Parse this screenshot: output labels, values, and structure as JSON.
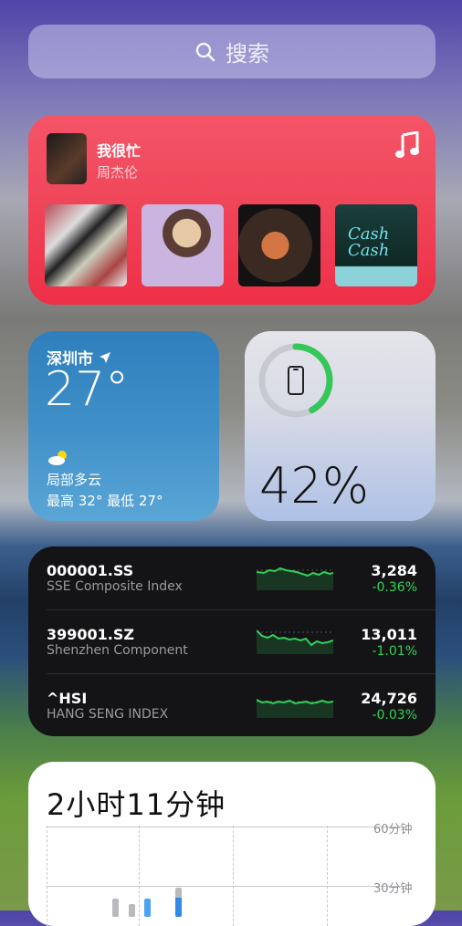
{
  "search": {
    "placeholder": "搜索",
    "icon": "search-icon"
  },
  "music": {
    "title": "我很忙",
    "artist": "周杰伦",
    "app_icon": "music-note-icon",
    "albums": [
      "album-1",
      "album-2",
      "album-3",
      "album-4"
    ],
    "album4_text": "Cash Cash"
  },
  "weather": {
    "city": "深圳市",
    "temperature": "27°",
    "condition": "局部多云",
    "range": "最高 32° 最低 27°"
  },
  "battery": {
    "percent": "42%",
    "level": 0.42,
    "accent": "#34c759"
  },
  "stocks": {
    "rows": [
      {
        "symbol": "000001.SS",
        "name": "SSE Composite Index",
        "price": "3,284",
        "change": "-0.36%"
      },
      {
        "symbol": "399001.SZ",
        "name": "Shenzhen Component",
        "price": "13,011",
        "change": "-1.01%"
      },
      {
        "symbol": "^HSI",
        "name": "HANG SENG INDEX",
        "price": "24,726",
        "change": "-0.03%"
      }
    ],
    "up_color": "#31d158"
  },
  "screentime": {
    "total": "2小时11分钟",
    "label_60": "60分钟",
    "label_30": "30分钟"
  }
}
